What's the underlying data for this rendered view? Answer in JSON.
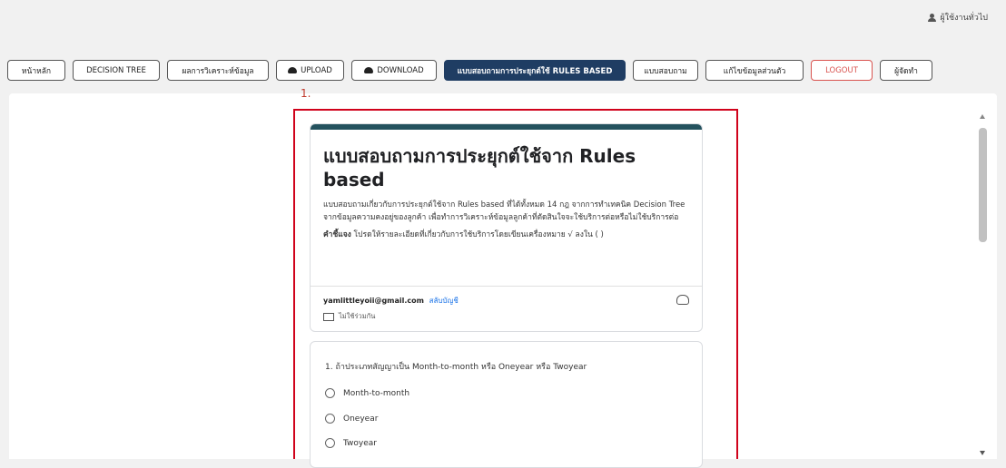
{
  "user": {
    "label": "ผู้ใช้งานทั่วไป",
    "icon": "user-icon"
  },
  "nav": [
    {
      "label": "หน้าหลัก",
      "icon": ""
    },
    {
      "label": "DECISION TREE",
      "icon": ""
    },
    {
      "label": "ผลการวิเคราะห์ข้อมูล",
      "icon": ""
    },
    {
      "label": "UPLOAD",
      "icon": "cloud-upload-icon"
    },
    {
      "label": "DOWNLOAD",
      "icon": "cloud-download-icon"
    },
    {
      "label": "แบบสอบถามการประยุกต์ใช้ RULES BASED",
      "icon": "",
      "active": true
    },
    {
      "label": "แบบสอบถาม",
      "icon": ""
    },
    {
      "label": "แก้ไขข้อมูลส่วนตัว",
      "icon": ""
    },
    {
      "label": "LOGOUT",
      "icon": ""
    },
    {
      "label": "ผู้จัดทำ",
      "icon": ""
    }
  ],
  "annotation": {
    "label": "1.",
    "color": "#d0021b"
  },
  "form": {
    "title": "แบบสอบถามการประยุกต์ใช้จาก Rules based",
    "description": "แบบสอบถามเกี่ยวกับการประยุกต์ใช้จาก Rules based ที่ได้ทั้งหมด 14 กฎ จากการทำเทคนิค Decision Tree จากข้อมูลความคงอยู่ของลูกค้า เพื่อทำการวิเคราะห์ข้อมูลลูกค้าที่ตัดสินใจจะใช้บริการต่อหรือไม่ใช้บริการต่อ",
    "note_label": "คำชี้แจง",
    "note_text": " โปรดให้รายละเอียดที่เกี่ยวกับการใช้บริการโดยเขียนเครื่องหมาย √ ลงใน ( )",
    "email": "yamlittleyoii@gmail.com",
    "switch_account": "สลับบัญชี",
    "not_shared": "ไม่ใช้ร่วมกัน",
    "accent_color": "#24525e"
  },
  "question": {
    "title": "1. ถ้าประเภทสัญญาเป็น Month-to-month หรือ Oneyear หรือ Twoyear",
    "options": [
      "Month-to-month",
      "Oneyear",
      "Twoyear"
    ]
  }
}
